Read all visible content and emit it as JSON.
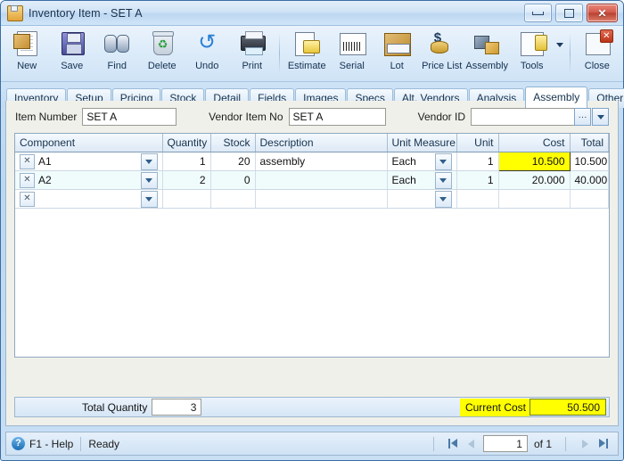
{
  "window": {
    "title": "Inventory Item - SET A",
    "icon": "inventory-item-icon",
    "controls": {
      "minimize": "minimize-icon",
      "restore": "restore-icon",
      "close": "✕"
    }
  },
  "toolbar": {
    "items": [
      {
        "label": "New",
        "icon": "new-document-icon"
      },
      {
        "label": "Save",
        "icon": "floppy-disk-icon"
      },
      {
        "label": "Find",
        "icon": "binoculars-icon"
      },
      {
        "label": "Delete",
        "icon": "recycle-bin-icon"
      },
      {
        "label": "Undo",
        "icon": "undo-arrow-icon"
      },
      {
        "label": "Print",
        "icon": "printer-icon"
      },
      {
        "label": "Estimate",
        "icon": "estimate-icon"
      },
      {
        "label": "Serial",
        "icon": "barcode-icon"
      },
      {
        "label": "Lot",
        "icon": "lot-box-icon"
      },
      {
        "label": "Price List",
        "icon": "price-list-icon"
      },
      {
        "label": "Assembly",
        "icon": "assembly-icon"
      },
      {
        "label": "Tools",
        "icon": "tools-icon"
      },
      {
        "label": "Close",
        "icon": "close-window-icon"
      }
    ]
  },
  "tabs": {
    "items": [
      "Inventory",
      "Setup",
      "Pricing",
      "Stock",
      "Detail",
      "Fields",
      "Images",
      "Specs",
      "Alt. Vendors",
      "Analysis",
      "Assembly",
      "Other Cost"
    ],
    "active": "Assembly"
  },
  "form": {
    "item_number_label": "Item Number",
    "item_number_value": "SET A",
    "vendor_item_no_label": "Vendor Item No",
    "vendor_item_no_value": "SET A",
    "vendor_id_label": "Vendor ID",
    "vendor_id_value": "",
    "ellipsis_button": "···"
  },
  "grid": {
    "columns": [
      "Component",
      "Quantity",
      "Stock",
      "Description",
      "Unit Measure",
      "Unit",
      "Cost",
      "Total"
    ],
    "rows": [
      {
        "component": "A1",
        "quantity": "1",
        "stock": "20",
        "description": "assembly",
        "unit_measure": "Each",
        "unit": "1",
        "cost": "10.500",
        "total": "10.500",
        "cost_highlighted": true,
        "selected": false
      },
      {
        "component": "A2",
        "quantity": "2",
        "stock": "0",
        "description": "",
        "unit_measure": "Each",
        "unit": "1",
        "cost": "20.000",
        "total": "40.000",
        "cost_highlighted": false,
        "selected": true
      },
      {
        "component": "",
        "quantity": "",
        "stock": "",
        "description": "",
        "unit_measure": "",
        "unit": "",
        "cost": "",
        "total": "",
        "cost_highlighted": false,
        "selected": false
      }
    ],
    "delete_button": "✕"
  },
  "totals": {
    "total_quantity_label": "Total Quantity",
    "total_quantity_value": "3",
    "current_cost_label": "Current Cost",
    "current_cost_value": "50.500"
  },
  "status": {
    "help_icon_glyph": "?",
    "help_label": "F1 - Help",
    "state": "Ready",
    "page_value": "1",
    "of_text": "of 1"
  },
  "colors": {
    "highlight_yellow": "#ffff00",
    "selected_row": "#f0fbfb",
    "accent_blue": "#3a6ea5",
    "close_red": "#bc3418"
  }
}
